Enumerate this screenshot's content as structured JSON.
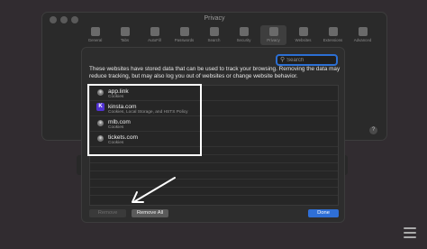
{
  "prefs_window": {
    "title": "Privacy",
    "toolbar": [
      {
        "label": "General"
      },
      {
        "label": "Tabs"
      },
      {
        "label": "AutoFill"
      },
      {
        "label": "Passwords"
      },
      {
        "label": "Search"
      },
      {
        "label": "Security"
      },
      {
        "label": "Privacy"
      },
      {
        "label": "Websites"
      },
      {
        "label": "Extensions"
      },
      {
        "label": "Advanced"
      }
    ],
    "active_tab": "Privacy",
    "help_label": "?"
  },
  "sheet": {
    "search": {
      "placeholder": "Search",
      "value": ""
    },
    "description": "These websites have stored data that can be used to track your browsing. Removing the data may reduce tracking, but may also log you out of websites or change website behavior.",
    "sites": [
      {
        "name": "app.link",
        "data": "Cookies",
        "icon": "globe-icon"
      },
      {
        "name": "kinsta.com",
        "data": "Cookies, Local Storage, and HSTS Policy",
        "icon": "kinsta-logo-icon",
        "icon_text": "K"
      },
      {
        "name": "mlb.com",
        "data": "Cookies",
        "icon": "globe-icon"
      },
      {
        "name": "tickets.com",
        "data": "Cookies",
        "icon": "globe-icon"
      }
    ],
    "buttons": {
      "remove": "Remove",
      "remove_all": "Remove All",
      "done": "Done"
    }
  },
  "colors": {
    "accent": "#2f6fd6",
    "annotation": "#ffffff",
    "background": "#312c30"
  }
}
